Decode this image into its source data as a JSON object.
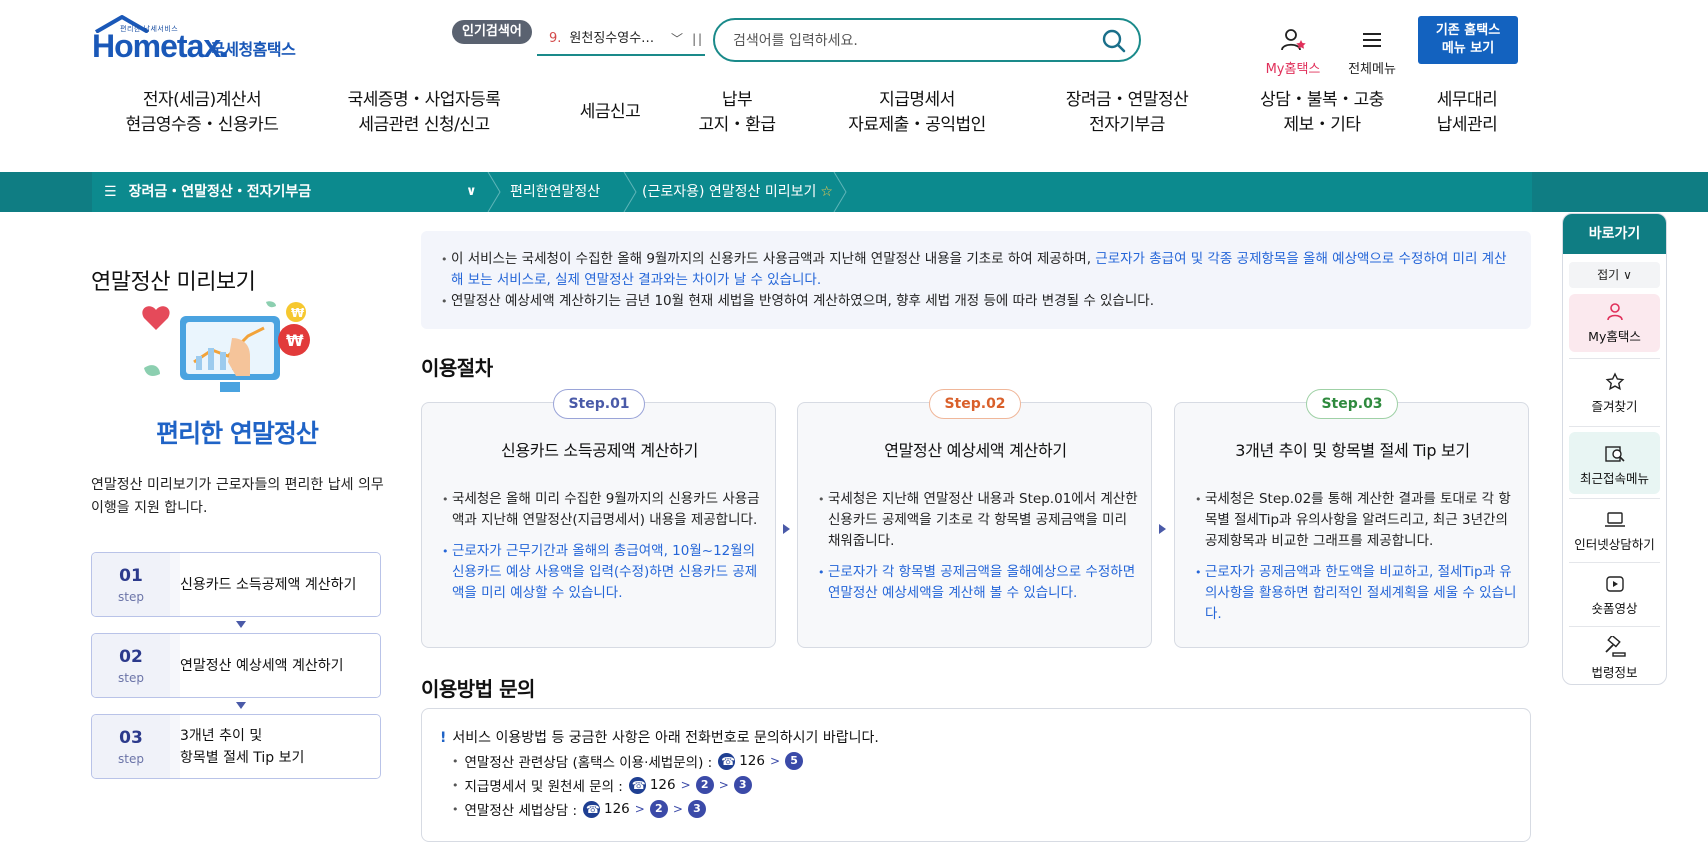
{
  "header": {
    "logo_small": "편리한 납세서비스",
    "logo_main": "Hometax.",
    "logo_sub": "국세청홈택스",
    "popular_tag": "인기검색어",
    "popular_rank": "9.",
    "popular_term": "원천징수영수…",
    "search_placeholder": "검색어를 입력하세요.",
    "my_hometax": "My홈택스",
    "all_menu": "전체메뉴",
    "old_menu_line1": "기존 홈택스",
    "old_menu_line2": "메뉴 보기"
  },
  "gnb": [
    {
      "line1": "전자(세금)계산서",
      "line2": "현금영수증・신용카드"
    },
    {
      "line1": "국세증명・사업자등록",
      "line2": "세금관련 신청/신고"
    },
    {
      "line1": "세금신고",
      "line2": ""
    },
    {
      "line1": "납부",
      "line2": "고지・환급"
    },
    {
      "line1": "지급명세서",
      "line2": "자료제출・공익법인"
    },
    {
      "line1": "장려금・연말정산",
      "line2": "전자기부금"
    },
    {
      "line1": "상담・불복・고충",
      "line2": "제보・기타"
    },
    {
      "line1": "세무대리",
      "line2": "납세관리"
    }
  ],
  "breadcrumb": {
    "menu": "장려금・연말정산・전자기부금",
    "level2": "편리한연말정산",
    "level3": "(근로자용) 연말정산 미리보기"
  },
  "left": {
    "title": "연말정산 미리보기",
    "illust_title": "편리한 연말정산",
    "desc": "연말정산 미리보기가 근로자들의  편리한 납세 의무 이행을 지원 합니다.",
    "steps": [
      {
        "num": "01",
        "unit": "step",
        "text": "신용카드 소득공제액 계산하기"
      },
      {
        "num": "02",
        "unit": "step",
        "text": "연말정산 예상세액 계산하기"
      },
      {
        "num": "03",
        "unit": "step",
        "text_line1": "3개년 추이 및",
        "text_line2": "항목별 절세 Tip 보기"
      }
    ]
  },
  "notice": {
    "line1_plain": "이 서비스는 국세청이 수집한 올해 9월까지의 신용카드 사용금액과 지난해 연말정산 내용을 기초로 하여 제공하며, ",
    "line1_highlight": "근로자가 총급여 및 각종 공제항목을 올해 예상액으로 수정하여 미리 계산해 보는 서비스로, 실제 연말정산 결과와는 차이가 날 수 있습니다.",
    "line2": "연말정산 예상세액 계산하기는 금년 10월 현재 세법을 반영하여 계산하였으며, 향후 세법 개정 등에 따라 변경될 수 있습니다."
  },
  "procedure": {
    "title": "이용절차",
    "cards": [
      {
        "badge": "Step.01",
        "badge_color": "#4a5aa8",
        "title": "신용카드 소득공제액 계산하기",
        "body": "국세청은 올해 미리 수집한 9월까지의 신용카드 사용금액과 지난해 연말정산(지급명세서) 내용을 제공합니다.",
        "body_blue": "근로자가 근무기간과 올해의 총급여액, 10월~12월의 신용카드 예상 사용액을 입력(수정)하면 신용카드 공제액을 미리 예상할 수 있습니다."
      },
      {
        "badge": "Step.02",
        "badge_color": "#d9602b",
        "title": "연말정산 예상세액 계산하기",
        "body": "국세청은 지난해 연말정산 내용과 Step.01에서 계산한 신용카드 공제액을 기초로 각 항목별 공제금액을 미리 채워줍니다.",
        "body_blue": "근로자가 각 항목별 공제금액을 올해예상으로 수정하면 연말정산 예상세액을 계산해 볼 수 있습니다."
      },
      {
        "badge": "Step.03",
        "badge_color": "#2f8a3e",
        "title": "3개년 추이 및 항목별 절세 Tip 보기",
        "body": "국세청은 Step.02를 통해 계산한 결과를 토대로 각 항목별 절세Tip과 유의사항을 알려드리고, 최근 3년간의 공제항목과 비교한 그래프를 제공합니다.",
        "body_blue": "근로자가 공제금액과 한도액을 비교하고, 절세Tip과 유의사항을 활용하면 합리적인 절세계획을 세울 수 있습니다."
      }
    ]
  },
  "inquiry": {
    "title": "이용방법 문의",
    "lead": "서비스 이용방법 등 궁금한 사항은 아래 전화번호로 문의하시기 바랍니다.",
    "rows": [
      {
        "label": "연말정산 관련상담 (홈택스 이용·세법문의) :",
        "number": "126",
        "steps": [
          "5"
        ]
      },
      {
        "label": "지급명세서 및 원천세 문의 :",
        "number": "126",
        "steps": [
          "2",
          "3"
        ]
      },
      {
        "label": "연말정산 세법상담 :",
        "number": "126",
        "steps": [
          "2",
          "3"
        ]
      }
    ]
  },
  "quick_menu": {
    "title": "바로가기",
    "fold": "접기",
    "items": [
      "My홈택스",
      "즐겨찾기",
      "최근접속메뉴",
      "인터넷상담하기",
      "숏폼영상",
      "법령정보"
    ]
  }
}
